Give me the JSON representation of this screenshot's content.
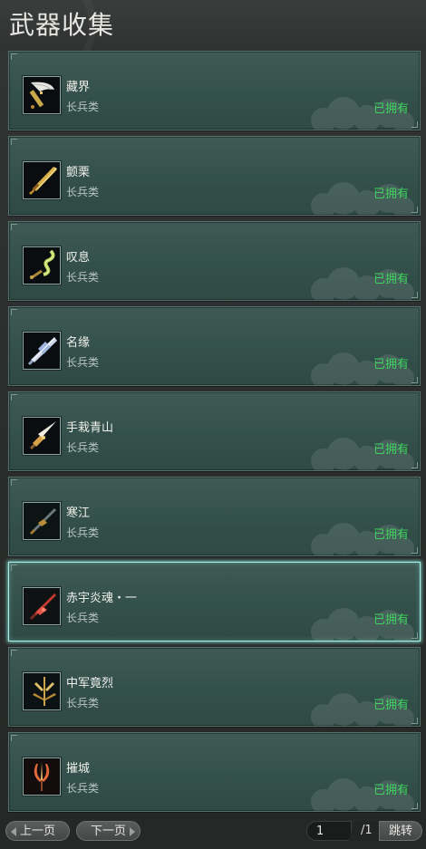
{
  "title": "武器收集",
  "items": [
    {
      "name": "藏界",
      "category": "长兵类",
      "status": "已拥有",
      "icon": "weapon-icon-cangjie",
      "selected": false
    },
    {
      "name": "颤栗",
      "category": "长兵类",
      "status": "已拥有",
      "icon": "weapon-icon-zhanli",
      "selected": false
    },
    {
      "name": "叹息",
      "category": "长兵类",
      "status": "已拥有",
      "icon": "weapon-icon-tanxi",
      "selected": false
    },
    {
      "name": "名缘",
      "category": "长兵类",
      "status": "已拥有",
      "icon": "weapon-icon-mingyuan",
      "selected": false
    },
    {
      "name": "手栽青山",
      "category": "长兵类",
      "status": "已拥有",
      "icon": "weapon-icon-shouzai",
      "selected": false
    },
    {
      "name": "寒江",
      "category": "长兵类",
      "status": "已拥有",
      "icon": "weapon-icon-hanjiang",
      "selected": false
    },
    {
      "name": "赤宇炎魂・一",
      "category": "长兵类",
      "status": "已拥有",
      "icon": "weapon-icon-chiyu",
      "selected": true
    },
    {
      "name": "中军竟烈",
      "category": "长兵类",
      "status": "已拥有",
      "icon": "weapon-icon-zhongjun",
      "selected": false
    },
    {
      "name": "摧城",
      "category": "长兵类",
      "status": "已拥有",
      "icon": "weapon-icon-cuicheng",
      "selected": false
    }
  ],
  "pagination": {
    "prev_label": "上一页",
    "next_label": "下一页",
    "current_page": "1",
    "total_pages": "/1",
    "goto_label": "跳转"
  },
  "colors": {
    "owned_status": "#3fd35f",
    "card_background": "#3a5550",
    "selected_border": "#a8f0e6"
  }
}
